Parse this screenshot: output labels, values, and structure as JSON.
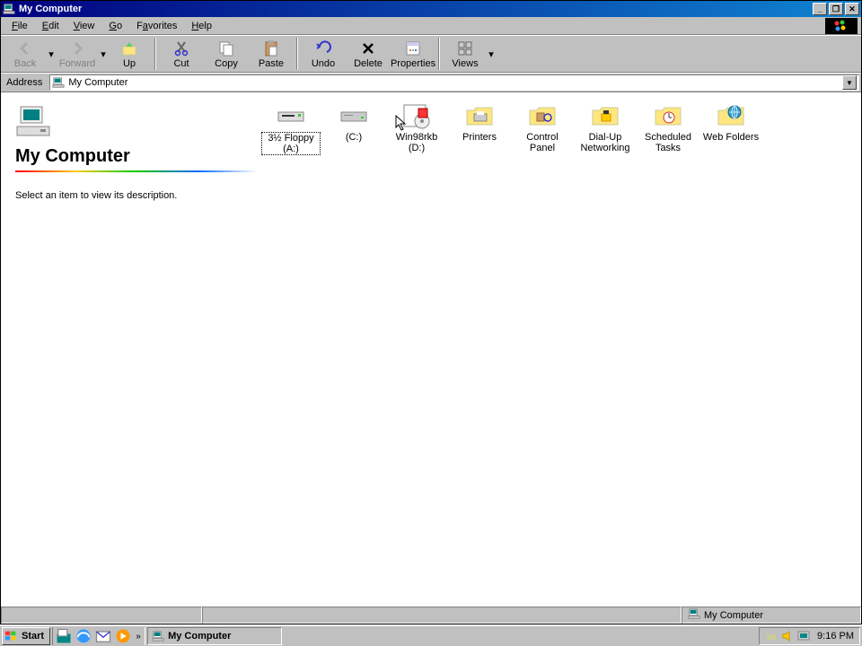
{
  "window": {
    "title": "My Computer"
  },
  "menus": [
    {
      "label": "File",
      "u": 0
    },
    {
      "label": "Edit",
      "u": 0
    },
    {
      "label": "View",
      "u": 0
    },
    {
      "label": "Go",
      "u": 0
    },
    {
      "label": "Favorites",
      "u": 1
    },
    {
      "label": "Help",
      "u": 0
    }
  ],
  "toolbar": [
    {
      "name": "back",
      "label": "Back",
      "disabled": true,
      "drop": true
    },
    {
      "name": "forward",
      "label": "Forward",
      "disabled": true,
      "drop": true
    },
    {
      "name": "up",
      "label": "Up",
      "disabled": false
    },
    {
      "sep": true
    },
    {
      "name": "cut",
      "label": "Cut",
      "disabled": false
    },
    {
      "name": "copy",
      "label": "Copy",
      "disabled": false
    },
    {
      "name": "paste",
      "label": "Paste",
      "disabled": false
    },
    {
      "sep": true
    },
    {
      "name": "undo",
      "label": "Undo",
      "disabled": false
    },
    {
      "name": "delete",
      "label": "Delete",
      "disabled": false
    },
    {
      "name": "properties",
      "label": "Properties",
      "disabled": false
    },
    {
      "sep": true
    },
    {
      "name": "views",
      "label": "Views",
      "disabled": false,
      "drop": true
    }
  ],
  "address": {
    "label": "Address",
    "value": "My Computer"
  },
  "infopane": {
    "heading": "My Computer",
    "description": "Select an item to view its description."
  },
  "icons": [
    {
      "name": "floppy-a",
      "label": "3½ Floppy (A:)",
      "type": "floppy",
      "selected": true
    },
    {
      "name": "drive-c",
      "label": "(C:)",
      "type": "hdd"
    },
    {
      "name": "drive-d",
      "label": "Win98rkb (D:)",
      "type": "cdrom"
    },
    {
      "name": "printers",
      "label": "Printers",
      "type": "sysfolder-printer"
    },
    {
      "name": "control-panel",
      "label": "Control Panel",
      "type": "sysfolder-cp"
    },
    {
      "name": "dialup",
      "label": "Dial-Up Networking",
      "type": "sysfolder-dun"
    },
    {
      "name": "scheduled-tasks",
      "label": "Scheduled Tasks",
      "type": "sysfolder-tasks"
    },
    {
      "name": "web-folders",
      "label": "Web Folders",
      "type": "sysfolder-web"
    }
  ],
  "statusbar": {
    "panel1": "",
    "panel2": "",
    "panel3": "My Computer"
  },
  "taskbar": {
    "start": "Start",
    "task": "My Computer",
    "clock": "9:16 PM"
  }
}
